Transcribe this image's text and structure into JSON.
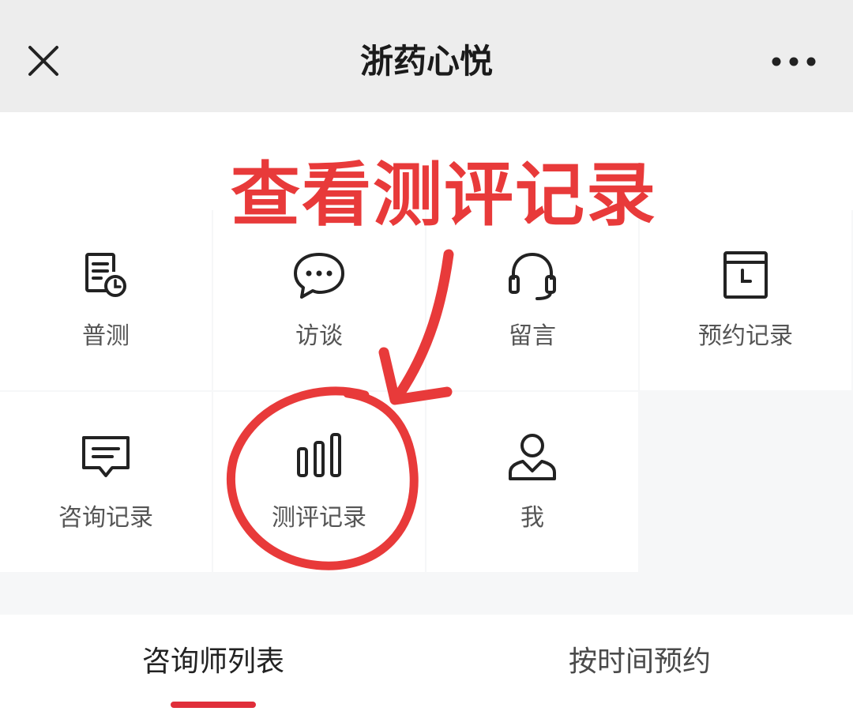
{
  "header": {
    "title": "浙药心悦",
    "close_icon": "close-icon",
    "more_icon": "more-horizontal-icon"
  },
  "grid": {
    "items": [
      {
        "label": "普测",
        "icon": "form-clock-icon"
      },
      {
        "label": "访谈",
        "icon": "chat-bubble-icon"
      },
      {
        "label": "留言",
        "icon": "headset-icon"
      },
      {
        "label": "预约记录",
        "icon": "calendar-clock-icon"
      },
      {
        "label": "咨询记录",
        "icon": "message-lines-icon"
      },
      {
        "label": "测评记录",
        "icon": "bar-chart-icon"
      },
      {
        "label": "我",
        "icon": "user-icon"
      }
    ]
  },
  "tabs": [
    {
      "label": "咨询师列表",
      "active": true
    },
    {
      "label": "按时间预约",
      "active": false
    }
  ],
  "annotation": {
    "text": "查看测评记录",
    "color": "#e83a3a"
  },
  "colors": {
    "accent": "#e02e3a",
    "header_bg": "#ededed",
    "page_bg": "#f6f7f8"
  }
}
